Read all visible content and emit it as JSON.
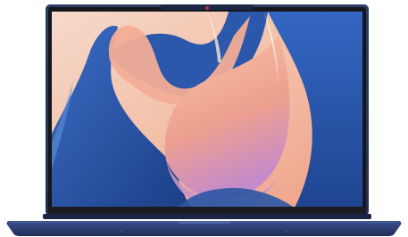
{
  "product": {
    "name": "",
    "colors": {
      "body": "#2d3f73",
      "body_dark": "#1d2b55",
      "bezel": "#1a1c22",
      "camera_led": "#e0303a",
      "wallpaper_peach": "#f3b59a",
      "wallpaper_blue": "#2f5fb0",
      "wallpaper_lilac": "#c9a0d6"
    }
  }
}
